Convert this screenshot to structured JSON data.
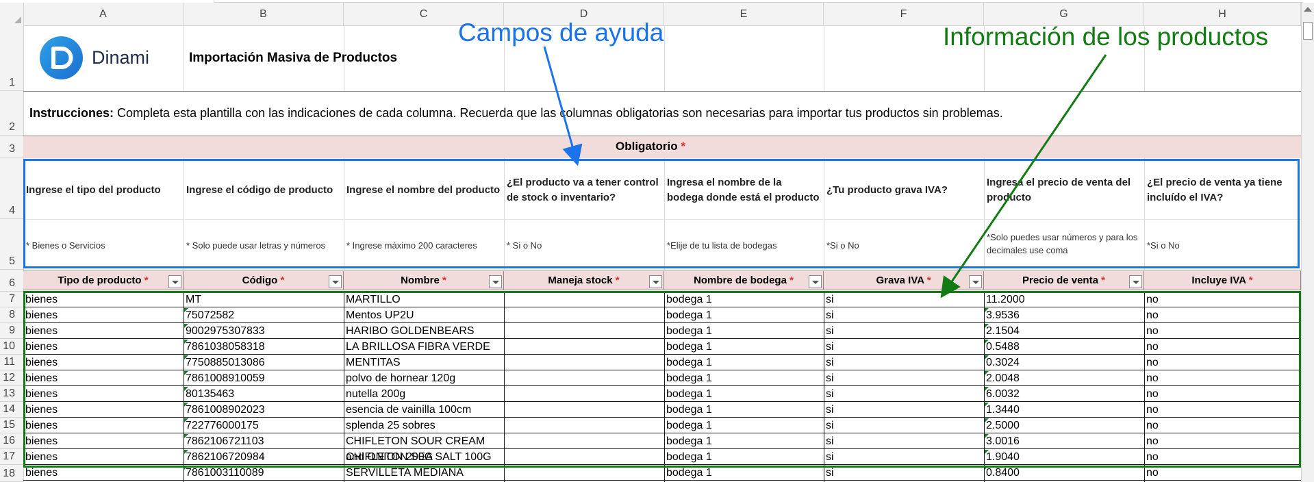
{
  "columns": [
    "A",
    "B",
    "C",
    "D",
    "E",
    "F",
    "G",
    "H"
  ],
  "rows": [
    "1",
    "2",
    "3",
    "4",
    "5",
    "6",
    "7",
    "8",
    "9",
    "10",
    "11",
    "12",
    "13",
    "14",
    "15",
    "16",
    "17",
    "18"
  ],
  "logo": {
    "text": "Dinami"
  },
  "title": "Importación Masiva de Productos",
  "instructions": {
    "bold": "Instrucciones:",
    "text": " Completa esta plantilla con las indicaciones de cada columna. Recuerda que las columnas obligatorias son necesarias para importar tus productos sin problemas."
  },
  "obligatorio": {
    "label": "Obligatorio",
    "star": "*"
  },
  "help_fields": [
    "Ingrese el tipo del producto",
    "Ingrese el código de producto",
    "Ingrese el nombre del producto",
    "¿El producto va a tener control de stock o inventario?",
    "Ingresa el nombre de la bodega donde está el producto",
    "¿Tu producto grava IVA?",
    "Ingresa el precio de venta del producto",
    "¿El precio de venta ya tiene incluído el IVA?"
  ],
  "hints": [
    "* Bienes o Servicios",
    "* Solo puede usar letras y números",
    "* Ingrese máximo 200 caracteres",
    "* Si o No",
    "*Elije de tu lista de bodegas",
    "*Si o No",
    "*Solo puedes usar números y para los decimales use coma",
    "*Si o No"
  ],
  "headers": [
    "Tipo de producto",
    "Código",
    "Nombre",
    "Maneja stock",
    "Nombre de bodega",
    "Grava IVA",
    "Precio de venta",
    "Incluye IVA"
  ],
  "header_star": "*",
  "data_rows": [
    [
      "bienes",
      "MT",
      "MARTILLO",
      "",
      "bodega 1",
      "si",
      "11.2000",
      "no"
    ],
    [
      "bienes",
      "75072582",
      "Mentos UP2U",
      "",
      "bodega 1",
      "si",
      "3.9536",
      "no"
    ],
    [
      "bienes",
      "9002975307833",
      "HARIBO GOLDENBEARS",
      "",
      "bodega 1",
      "si",
      "2.1504",
      "no"
    ],
    [
      "bienes",
      "7861038058318",
      "LA BRILLOSA FIBRA VERDE",
      "",
      "bodega 1",
      "si",
      "0.5488",
      "no"
    ],
    [
      "bienes",
      "7750885013086",
      "MENTITAS",
      "",
      "bodega 1",
      "si",
      "0.3024",
      "no"
    ],
    [
      "bienes",
      "7861008910059",
      "polvo de hornear 120g",
      "",
      "bodega 1",
      "si",
      "2.0048",
      "no"
    ],
    [
      "bienes",
      "80135463",
      "nutella 200g",
      "",
      "bodega 1",
      "si",
      "6.0032",
      "no"
    ],
    [
      "bienes",
      "7861008902023",
      "esencia de vainilla 100cm",
      "",
      "bodega 1",
      "si",
      "1.3440",
      "no"
    ],
    [
      "bienes",
      "722776000175",
      "splenda 25 sobres",
      "",
      "bodega 1",
      "si",
      "2.5000",
      "no"
    ],
    [
      "bienes",
      "7862106721103",
      "CHIFLETON SOUR CREAM and ONION 200G",
      "",
      "bodega 1",
      "si",
      "3.0016",
      "no"
    ],
    [
      "bienes",
      "7862106720984",
      "CHIFLETON SEA SALT 100G",
      "",
      "bodega 1",
      "si",
      "1.9040",
      "no"
    ],
    [
      "bienes",
      "7861003110089",
      "SERVILLETA MEDIANA",
      "",
      "bodega 1",
      "si",
      "0.8400",
      "no"
    ]
  ],
  "annotations": {
    "help": "Campos de ayuda",
    "products": "Información de los productos"
  },
  "colors": {
    "annotation_blue": "#1a73e8",
    "annotation_green": "#137b13",
    "header_fill": "#f2dcdb",
    "required_star": "#e03030"
  }
}
